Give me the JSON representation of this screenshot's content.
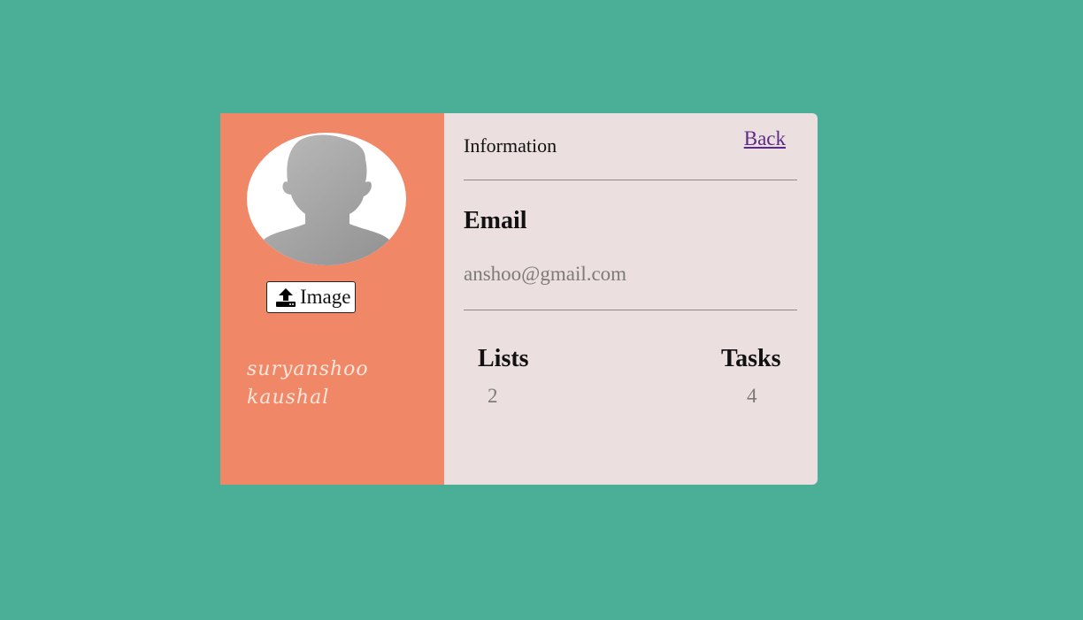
{
  "profile": {
    "name": "suryanshoo kaushal",
    "upload_label": "Image",
    "avatar_icon": "default-user-avatar",
    "upload_icon": "upload-icon"
  },
  "info": {
    "title": "Information",
    "back_label": "Back",
    "email_heading": "Email",
    "email_value": "anshoo@gmail.com"
  },
  "stats": {
    "lists_label": "Lists",
    "lists_value": "2",
    "tasks_label": "Tasks",
    "tasks_value": "4"
  },
  "colors": {
    "background": "#4aaf96",
    "sidebar": "#f08868",
    "panel": "#ebdfdf",
    "link": "#5b2a86"
  }
}
